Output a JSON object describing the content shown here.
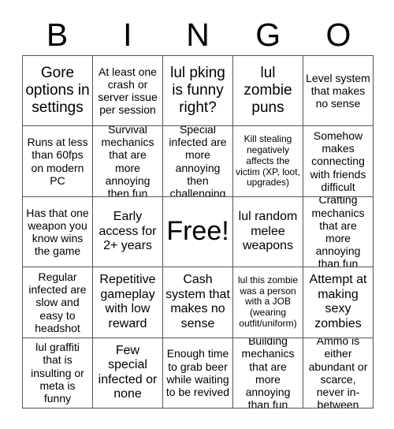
{
  "header": {
    "letters": [
      "B",
      "I",
      "N",
      "G",
      "O"
    ]
  },
  "grid": {
    "columns": 5,
    "rows": 5,
    "cells": [
      {
        "text": "Gore options in settings",
        "size": "lg"
      },
      {
        "text": "At least one crash or server issue per session",
        "size": "sm"
      },
      {
        "text": "lul pking is funny right?",
        "size": "lg"
      },
      {
        "text": "lul zombie puns",
        "size": "lg"
      },
      {
        "text": "Level system that makes no sense",
        "size": "sm"
      },
      {
        "text": "Runs at less than 60fps on modern PC",
        "size": "sm"
      },
      {
        "text": "Survival mechanics that are more annoying then fun",
        "size": "sm"
      },
      {
        "text": "Special infected are more annoying then challenging",
        "size": "sm"
      },
      {
        "text": "Kill stealing negatively affects the victim (XP, loot, upgrades)",
        "size": "xs"
      },
      {
        "text": "Somehow makes connecting with friends difficult",
        "size": "sm"
      },
      {
        "text": "Has that one weapon you know wins the game",
        "size": "sm"
      },
      {
        "text": "Early access for 2+ years",
        "size": "md"
      },
      {
        "text": "Free!",
        "size": "xl"
      },
      {
        "text": "lul random melee weapons",
        "size": "md"
      },
      {
        "text": "Crafting mechanics that are more annoying than fun",
        "size": "sm"
      },
      {
        "text": "Regular infected are slow and easy to headshot",
        "size": "sm"
      },
      {
        "text": "Repetitive gameplay with low reward",
        "size": "md"
      },
      {
        "text": "Cash system that makes no sense",
        "size": "md"
      },
      {
        "text": "lul this zombie was a person with a JOB (wearing outfit/uniform)",
        "size": "xs"
      },
      {
        "text": "Attempt at making sexy zombies",
        "size": "md"
      },
      {
        "text": "lul graffiti that is insulting or meta is funny",
        "size": "sm"
      },
      {
        "text": "Few special infected or none",
        "size": "md"
      },
      {
        "text": "Enough time to grab beer while waiting to be revived",
        "size": "sm"
      },
      {
        "text": "Building mechanics that are more annoying than fun",
        "size": "sm"
      },
      {
        "text": "Ammo is either abundant or scarce, never in-between",
        "size": "sm"
      }
    ]
  },
  "colors": {
    "background": "#ffffff",
    "text": "#000000",
    "grid_line": "#555555"
  }
}
